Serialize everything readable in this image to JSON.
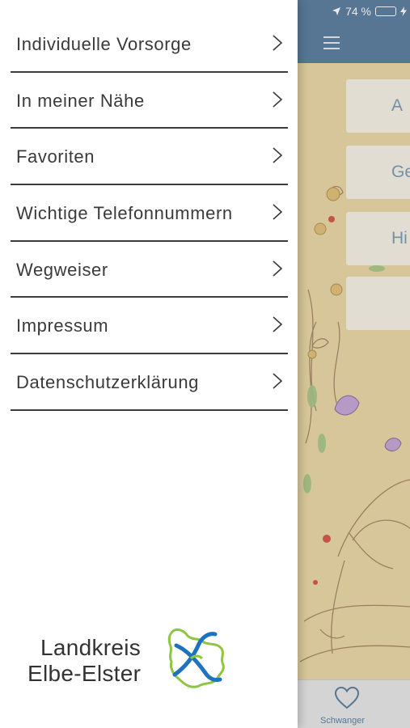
{
  "status_bar": {
    "battery_text": "74 %",
    "battery_level": 0.74,
    "icons": [
      "location-arrow-icon",
      "battery-icon",
      "charging-bolt-icon"
    ]
  },
  "drawer": {
    "menu": [
      {
        "label": "Individuelle Vorsorge",
        "icon": "chevron-right-icon"
      },
      {
        "label": "In meiner Nähe",
        "icon": "chevron-right-icon"
      },
      {
        "label": "Favoriten",
        "icon": "chevron-right-icon"
      },
      {
        "label": "Wichtige Telefonnummern",
        "icon": "chevron-right-icon"
      },
      {
        "label": "Wegweiser",
        "icon": "chevron-right-icon"
      },
      {
        "label": "Impressum",
        "icon": "chevron-right-icon"
      },
      {
        "label": "Datenschutzerklärung",
        "icon": "chevron-right-icon"
      }
    ],
    "logo": {
      "line1": "Landkreis",
      "line2": "Elbe-Elster",
      "colors": {
        "green": "#8dc63f",
        "blue": "#1e73be"
      }
    }
  },
  "app": {
    "nav_icon": "hamburger-menu-icon",
    "cards": [
      {
        "text": "A"
      },
      {
        "text": "Ge"
      },
      {
        "text": "Hi"
      },
      {
        "text": ""
      }
    ],
    "tabbar": {
      "active_tab": {
        "label": "Schwanger",
        "icon": "heart-icon"
      }
    }
  },
  "colors": {
    "nav_blue": "#5d7fa0",
    "menu_text": "#3a3a3a",
    "divider": "#3c3c3c",
    "background_cream": "#e9d8a8"
  }
}
